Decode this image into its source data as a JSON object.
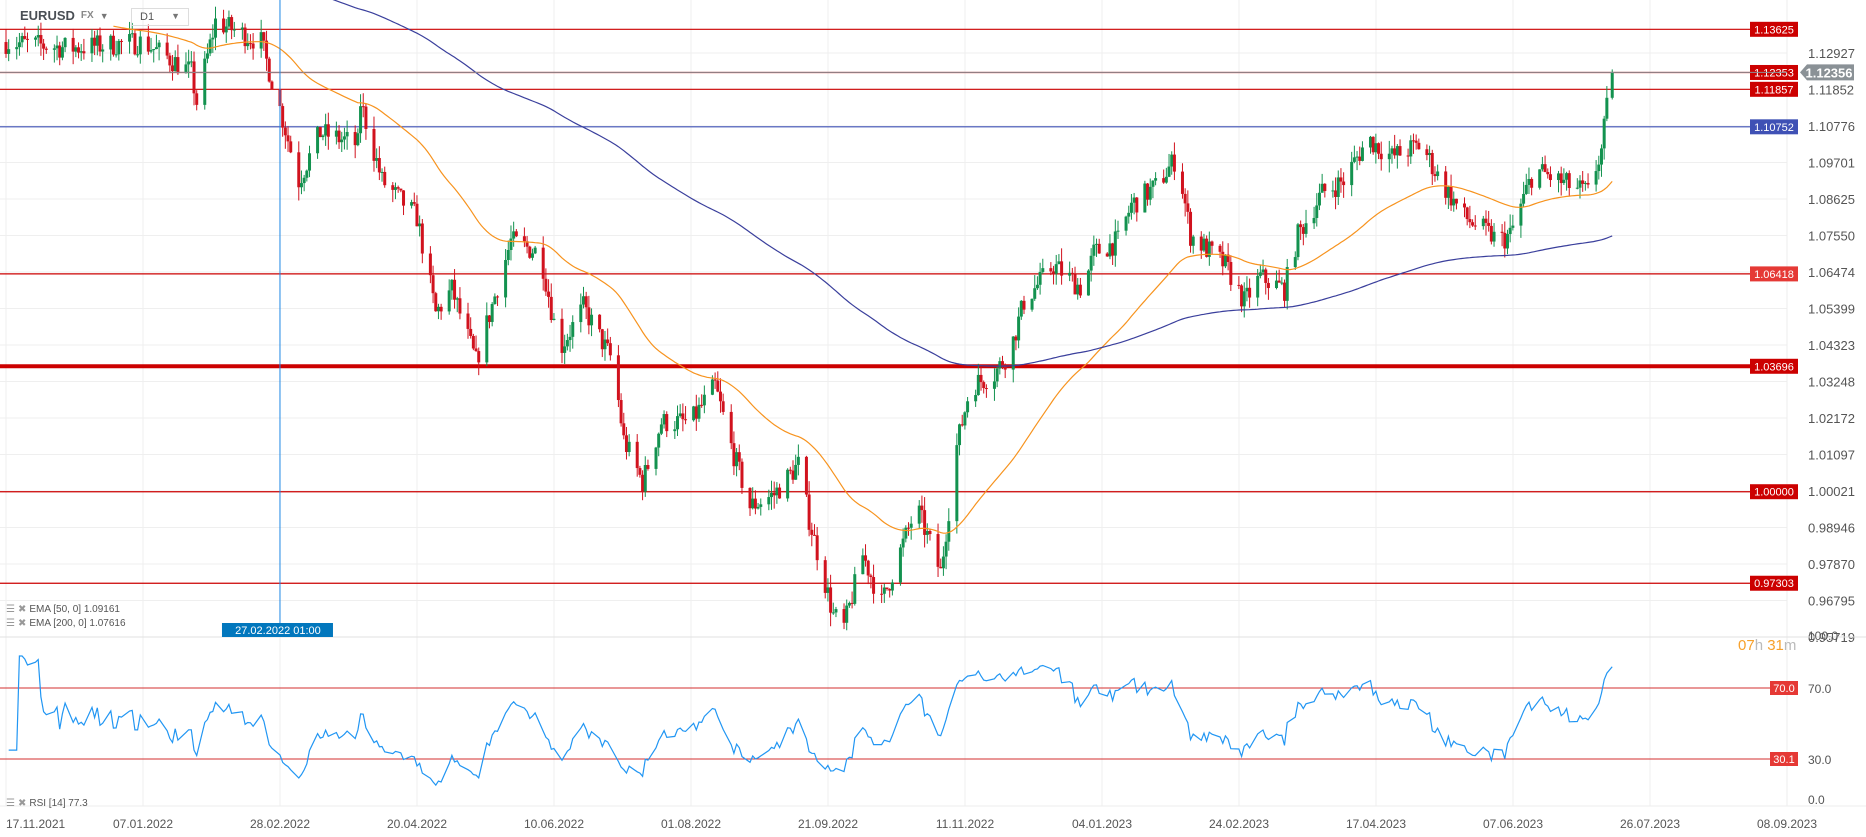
{
  "header": {
    "symbol": "EURUSD",
    "market": "FX",
    "timeframe": "D1"
  },
  "legend": {
    "ema50": "EMA [50, 0] 1.09161",
    "ema200": "EMA [200, 0] 1.07616",
    "rsi": "RSI [14] 77.3"
  },
  "countdown": {
    "hours": "07",
    "h": "h",
    "minutes": "31",
    "m": "m"
  },
  "crosshair": {
    "label": "27.02.2022 01:00",
    "day": 102
  },
  "colors": {
    "up": "#13924f",
    "down": "#d1121e",
    "ema50": "#f7931e",
    "ema200": "#3a3f9c",
    "rsi": "#2196f3",
    "level": "#cc0000",
    "blue_level": "#3f51b5",
    "current": "#8a9196"
  },
  "chart_data": {
    "type": "candlestick",
    "title": "EURUSD FX D1",
    "x_start": "17.11.2021",
    "x_ticks": [
      "17.11.2021",
      "07.01.2022",
      "28.02.2022",
      "20.04.2022",
      "10.06.2022",
      "01.08.2022",
      "21.09.2022",
      "11.11.2022",
      "04.01.2023",
      "24.02.2023",
      "17.04.2023",
      "07.06.2023",
      "26.07.2023",
      "08.09.2023"
    ],
    "y_ticks": [
      "1.12927",
      "1.11852",
      "1.10776",
      "1.09701",
      "1.08625",
      "1.07550",
      "1.06474",
      "1.05399",
      "1.04323",
      "1.03248",
      "1.02172",
      "1.01097",
      "1.00021",
      "0.98946",
      "0.97870",
      "0.96795",
      "0.95719"
    ],
    "ylim": [
      0.95719,
      1.13625
    ],
    "close_anchors_day_price": [
      [
        0,
        1.1325
      ],
      [
        24,
        1.1307
      ],
      [
        51,
        1.1325
      ],
      [
        69,
        1.1236
      ],
      [
        71,
        1.1147
      ],
      [
        78,
        1.1385
      ],
      [
        95,
        1.1325
      ],
      [
        102,
        1.1129
      ],
      [
        109,
        1.0916
      ],
      [
        117,
        1.1058
      ],
      [
        131,
        1.1023
      ],
      [
        132,
        1.1147
      ],
      [
        140,
        1.0916
      ],
      [
        153,
        1.0809
      ],
      [
        160,
        1.0525
      ],
      [
        166,
        1.0596
      ],
      [
        175,
        1.0383
      ],
      [
        184,
        1.0632
      ],
      [
        188,
        1.0738
      ],
      [
        199,
        1.0703
      ],
      [
        206,
        1.0418
      ],
      [
        215,
        1.0543
      ],
      [
        226,
        1.0383
      ],
      [
        230,
        1.0152
      ],
      [
        237,
        1.0027
      ],
      [
        244,
        1.0205
      ],
      [
        255,
        1.0205
      ],
      [
        264,
        1.0311
      ],
      [
        270,
        1.0134
      ],
      [
        277,
        0.9956
      ],
      [
        286,
        0.9992
      ],
      [
        295,
        1.008
      ],
      [
        299,
        0.992
      ],
      [
        308,
        0.9636
      ],
      [
        312,
        0.96
      ],
      [
        319,
        0.9814
      ],
      [
        326,
        0.9672
      ],
      [
        339,
        0.9956
      ],
      [
        348,
        0.9761
      ],
      [
        354,
        1.0134
      ],
      [
        359,
        1.0311
      ],
      [
        368,
        1.0347
      ],
      [
        374,
        1.0418
      ],
      [
        379,
        1.056
      ],
      [
        390,
        1.0667
      ],
      [
        401,
        1.0596
      ],
      [
        405,
        1.0703
      ],
      [
        414,
        1.0738
      ],
      [
        419,
        1.0845
      ],
      [
        428,
        1.0898
      ],
      [
        436,
        1.0987
      ],
      [
        441,
        1.0756
      ],
      [
        454,
        1.0667
      ],
      [
        461,
        1.056
      ],
      [
        467,
        1.0632
      ],
      [
        476,
        1.0596
      ],
      [
        481,
        1.0756
      ],
      [
        490,
        1.088
      ],
      [
        498,
        1.0916
      ],
      [
        507,
        1.104
      ],
      [
        516,
        1.0987
      ],
      [
        527,
        1.1023
      ],
      [
        534,
        1.0916
      ],
      [
        543,
        1.0809
      ],
      [
        556,
        1.0738
      ],
      [
        560,
        1.0756
      ],
      [
        569,
        1.0951
      ],
      [
        578,
        1.0916
      ],
      [
        589,
        1.088
      ],
      [
        594,
        1.1005
      ],
      [
        596,
        1.1129
      ],
      [
        598,
        1.12356
      ]
    ],
    "levels": [
      {
        "price": 1.13625,
        "label": "1.13625",
        "kind": "red"
      },
      {
        "price": 1.12353,
        "label": "1.12353",
        "kind": "red"
      },
      {
        "price": 1.11857,
        "label": "1.11857",
        "kind": "red"
      },
      {
        "price": 1.10752,
        "label": "1.10752",
        "kind": "blue"
      },
      {
        "price": 1.06418,
        "label": "1.06418",
        "kind": "red"
      },
      {
        "price": 1.03696,
        "label": "1.03696",
        "kind": "thick"
      },
      {
        "price": 1.0,
        "label": "1.00000",
        "kind": "red"
      },
      {
        "price": 0.97303,
        "label": "0.97303",
        "kind": "red"
      }
    ],
    "current_price": {
      "value": 1.12356,
      "label": "1.12356"
    },
    "indicators": {
      "ema": [
        50,
        200
      ],
      "ema50_last": 1.09161,
      "ema200_last": 1.07616
    },
    "rsi": {
      "period": 14,
      "last": 77.3,
      "ylim": [
        0,
        100
      ],
      "y_ticks": [
        "100.0",
        "70.0",
        "30.0",
        "0.0"
      ],
      "levels": [
        {
          "value": 70,
          "label": "70.0"
        },
        {
          "value": 30,
          "label": "30.1"
        }
      ]
    }
  }
}
